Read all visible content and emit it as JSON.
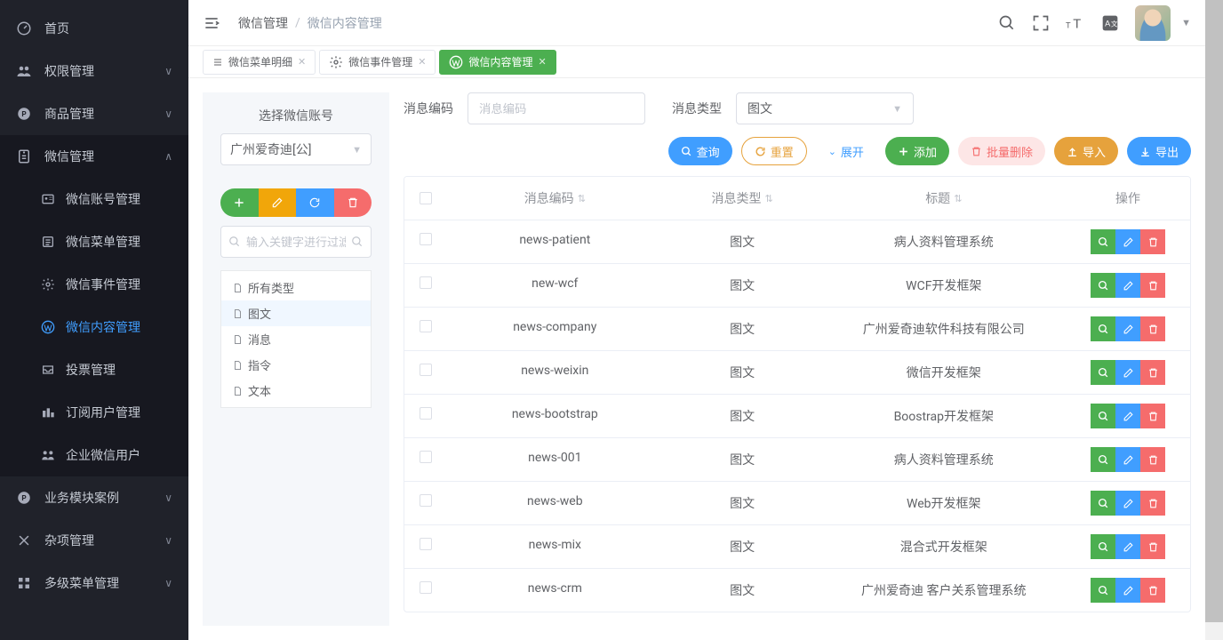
{
  "breadcrumb": {
    "root": "微信管理",
    "current": "微信内容管理"
  },
  "sidebar": [
    {
      "icon": "dashboard",
      "label": "首页",
      "expandable": false
    },
    {
      "icon": "users",
      "label": "权限管理",
      "expandable": true
    },
    {
      "icon": "product",
      "label": "商品管理",
      "expandable": true
    },
    {
      "icon": "wechat",
      "label": "微信管理",
      "expandable": true,
      "expanded": true,
      "children": [
        {
          "icon": "card",
          "label": "微信账号管理"
        },
        {
          "icon": "menu",
          "label": "微信菜单管理"
        },
        {
          "icon": "gear",
          "label": "微信事件管理"
        },
        {
          "icon": "wp",
          "label": "微信内容管理",
          "active": true
        },
        {
          "icon": "inbox",
          "label": "投票管理"
        },
        {
          "icon": "subscribers",
          "label": "订阅用户管理"
        },
        {
          "icon": "enterprise",
          "label": "企业微信用户"
        }
      ]
    },
    {
      "icon": "module",
      "label": "业务模块案例",
      "expandable": true
    },
    {
      "icon": "misc",
      "label": "杂项管理",
      "expandable": true
    },
    {
      "icon": "multilevel",
      "label": "多级菜单管理",
      "expandable": true
    }
  ],
  "tabs": [
    {
      "icon": "list",
      "label": "微信菜单明细",
      "active": false
    },
    {
      "icon": "gear",
      "label": "微信事件管理",
      "active": false
    },
    {
      "icon": "wp",
      "label": "微信内容管理",
      "active": true
    }
  ],
  "leftPanel": {
    "title": "选择微信账号",
    "accountSelected": "广州爱奇迪[公]",
    "searchPlaceholder": "输入关键字进行过滤",
    "treeItems": [
      {
        "label": "所有类型",
        "selected": false
      },
      {
        "label": "图文",
        "selected": true
      },
      {
        "label": "消息",
        "selected": false
      },
      {
        "label": "指令",
        "selected": false
      },
      {
        "label": "文本",
        "selected": false
      }
    ]
  },
  "filters": {
    "msgCode": {
      "label": "消息编码",
      "placeholder": "消息编码"
    },
    "msgType": {
      "label": "消息类型",
      "selected": "图文"
    }
  },
  "actions": {
    "query": "查询",
    "reset": "重置",
    "expand": "展开",
    "add": "添加",
    "batchDelete": "批量删除",
    "import": "导入",
    "export": "导出"
  },
  "table": {
    "headers": {
      "code": "消息编码",
      "type": "消息类型",
      "title": "标题",
      "ops": "操作"
    },
    "rows": [
      {
        "code": "news-patient",
        "type": "图文",
        "title": "病人资料管理系统"
      },
      {
        "code": "new-wcf",
        "type": "图文",
        "title": "WCF开发框架"
      },
      {
        "code": "news-company",
        "type": "图文",
        "title": "广州爱奇迪软件科技有限公司"
      },
      {
        "code": "news-weixin",
        "type": "图文",
        "title": "微信开发框架"
      },
      {
        "code": "news-bootstrap",
        "type": "图文",
        "title": "Boostrap开发框架"
      },
      {
        "code": "news-001",
        "type": "图文",
        "title": "病人资料管理系统"
      },
      {
        "code": "news-web",
        "type": "图文",
        "title": "Web开发框架"
      },
      {
        "code": "news-mix",
        "type": "图文",
        "title": "混合式开发框架"
      },
      {
        "code": "news-crm",
        "type": "图文",
        "title": "广州爱奇迪 客户关系管理系统"
      }
    ]
  }
}
